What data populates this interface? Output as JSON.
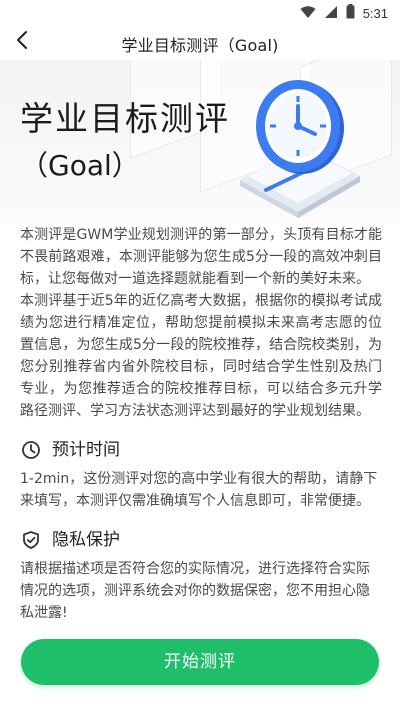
{
  "status_bar": {
    "time": "5:31",
    "icons": [
      "wifi-icon",
      "cellular-icon",
      "battery-icon"
    ]
  },
  "nav": {
    "title": "学业目标测评（Goal)",
    "back_icon": "back-arrow-icon"
  },
  "hero": {
    "title": "学业目标测评",
    "subtitle": "（Goal）",
    "illustration": "clock-on-book-illustration"
  },
  "intro": {
    "paragraph1": "本测评是GWM学业规划测评的第一部分，头顶有目标才能不畏前路艰难，本测评能够为您生成5分一段的高效冲刺目标，让您每做对一道选择题就能看到一个新的美好未来。",
    "paragraph2": "本测评基于近5年的近亿高考大数据，根据你的模拟考试成绩为您进行精准定位，帮助您提前模拟未来高考志愿的位置信息，为您生成5分一段的院校推荐，结合院校类别，为您分别推荐省内省外院校目标，同时结合学生性别及热门专业，为您推荐适合的院校推荐目标，可以结合多元升学路径测评、学习方法状态测评达到最好的学业规划结果。"
  },
  "sections": {
    "time": {
      "icon": "clock-icon",
      "title": "预计时间",
      "body": "1-2min，这份测评对您的高中学业有很大的帮助，请静下来填写，本测评仅需准确填写个人信息即可，非常便捷。"
    },
    "privacy": {
      "icon": "shield-check-icon",
      "title": "隐私保护",
      "body": "请根据描述项是否符合您的实际情况，进行选择符合实际情况的选项，测评系统会对你的数据保密，您不用担心隐私泄露!"
    }
  },
  "footer": {
    "start_label": "开始测评"
  },
  "colors": {
    "accent": "#1fbf6a",
    "clock_blue": "#3d7bf0",
    "text": "#4a4a4a"
  }
}
